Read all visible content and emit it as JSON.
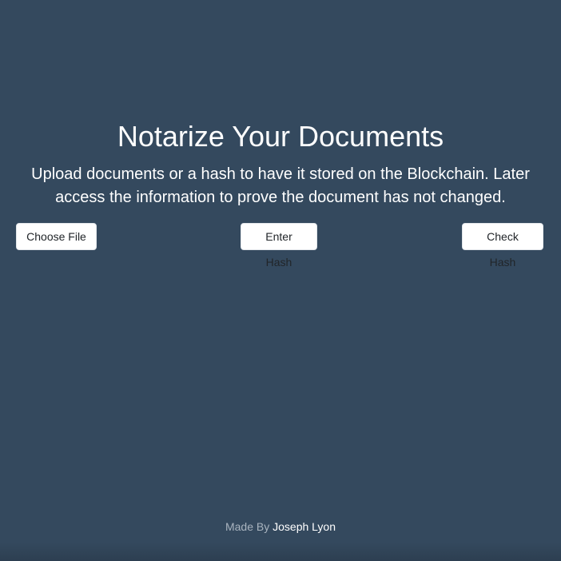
{
  "header": {
    "title": "Notarize Your Documents",
    "subtitle": "Upload documents or a hash to have it stored on the Blockchain. Later access the information to prove the document has not changed."
  },
  "actions": {
    "choose_file_label": "Choose File",
    "enter_hash_label": "Enter Hash",
    "check_hash_label": "Check Hash"
  },
  "footer": {
    "made_by": "Made By",
    "author": "Joseph Lyon"
  },
  "colors": {
    "background": "#34495e",
    "button_bg": "#ffffff",
    "text": "#ffffff"
  }
}
